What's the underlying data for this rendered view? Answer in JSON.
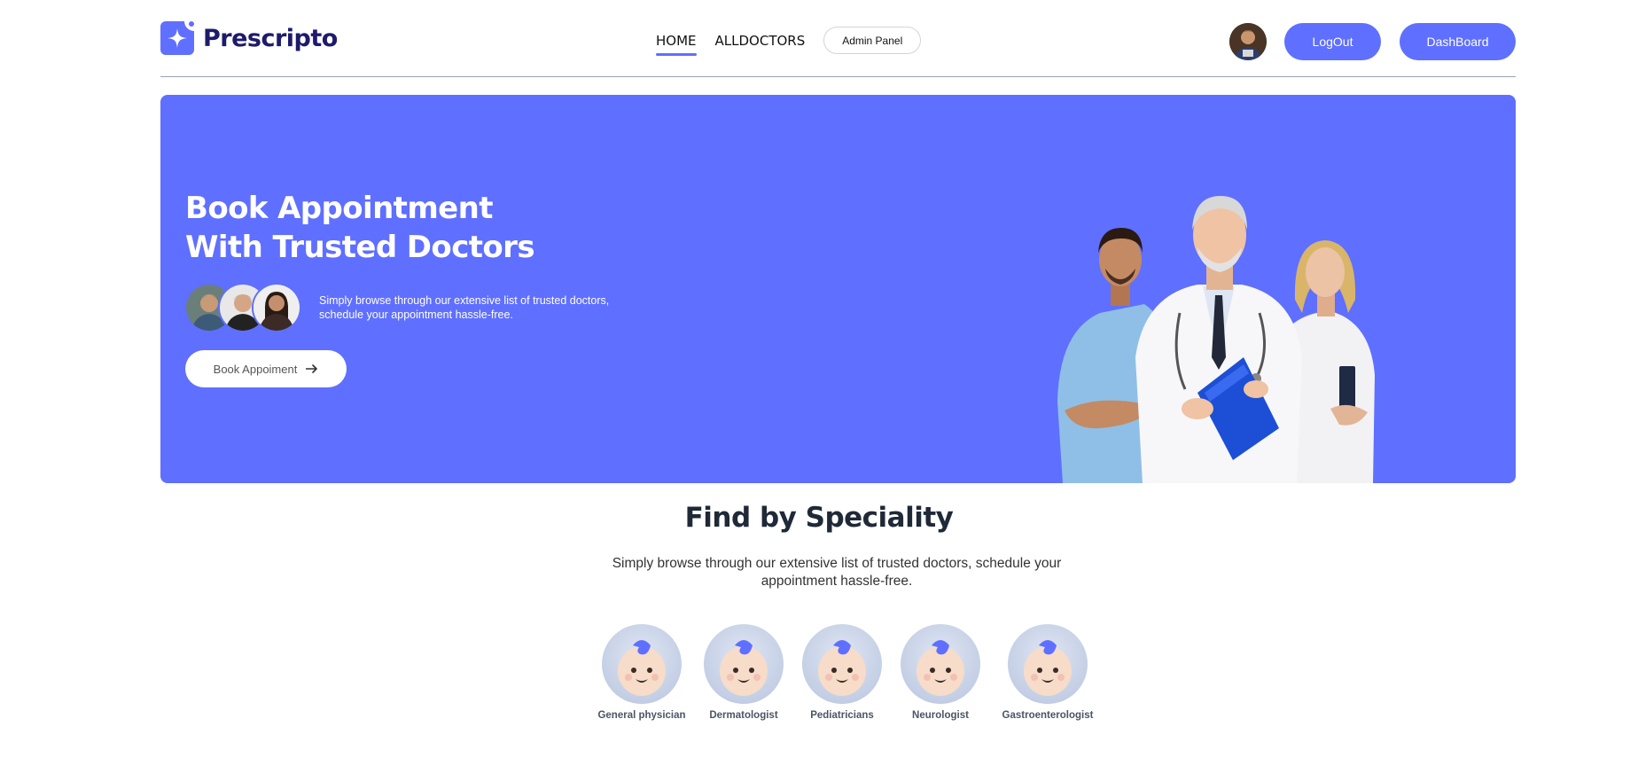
{
  "brand": {
    "name": "Prescripto",
    "icon": "logo-sparkle-icon",
    "accent": "#5f6fff",
    "dark": "#1e1b6b"
  },
  "nav": {
    "links": [
      {
        "label": "HOME",
        "active": true
      },
      {
        "label": "ALLDOCTORS",
        "active": false
      }
    ],
    "admin_label": "Admin Panel",
    "logout_label": "LogOut",
    "dashboard_label": "DashBoard",
    "avatar_icon": "user-avatar"
  },
  "hero": {
    "title_line1": "Book Appointment",
    "title_line2": "With Trusted Doctors",
    "subtitle_line1": "Simply browse through our extensive list of trusted doctors,",
    "subtitle_line2": "schedule your appointment hassle-free.",
    "cta_label": "Book Appoiment",
    "cta_icon": "arrow-right-icon",
    "background": "#5f6fff"
  },
  "speciality": {
    "title": "Find by Speciality",
    "subtitle_line1": "Simply browse through our extensive list of trusted doctors, schedule your",
    "subtitle_line2": "appointment hassle-free.",
    "items": [
      {
        "label": "General physician",
        "icon": "baby-face-icon"
      },
      {
        "label": "Dermatologist",
        "icon": "baby-face-icon"
      },
      {
        "label": "Pediatricians",
        "icon": "baby-face-icon"
      },
      {
        "label": "Neurologist",
        "icon": "baby-face-icon"
      },
      {
        "label": "Gastroenterologist",
        "icon": "baby-face-icon"
      }
    ]
  }
}
